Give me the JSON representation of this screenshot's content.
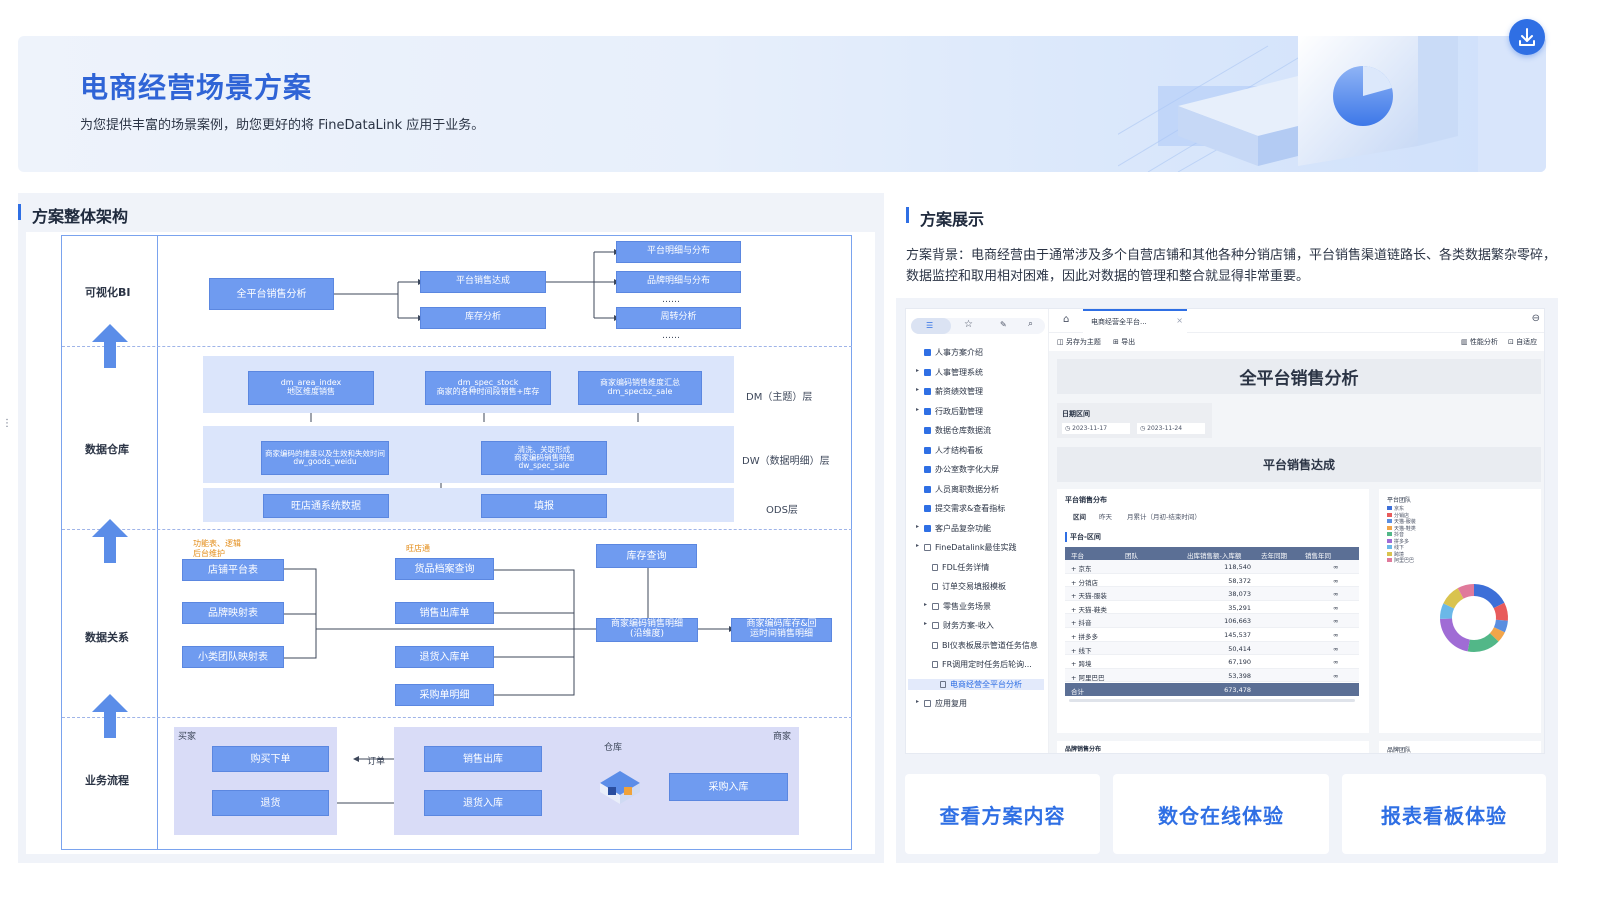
{
  "hero": {
    "title": "电商经营场景方案",
    "subtitle": "为您提供丰富的场景案例，助您更好的将 FineDataLink 应用于业务。"
  },
  "download_icon": "download-icon",
  "left": {
    "title": "方案整体架构",
    "rows": [
      "可视化BI",
      "数据仓库",
      "数据关系",
      "业务流程"
    ],
    "bi": {
      "root": "全平台销售分析",
      "mid": [
        "平台销售达成",
        "库存分析"
      ],
      "right": [
        "平台明细与分布",
        "品牌明细与分布",
        "……",
        "周转分析",
        "……"
      ]
    },
    "dw": {
      "dm_nodes": [
        "dm_area_index\n地区维度销售",
        "dm_spec_stock\n商家的各种时间段销售+库存",
        "商家编码销售维度汇总\ndm_specbz_sale"
      ],
      "dm_label": "DM（主题）层",
      "dw_nodes": [
        "商家编码的维度以及生效和失效时间\ndw_goods_weidu",
        "清洗、关联形成\n商家编码销售明细\ndw_spec_sale"
      ],
      "dw_label": "DW（数据明细）层",
      "ods_nodes": [
        "旺店通系统数据",
        "填报"
      ],
      "ods_label": "ODS层"
    },
    "rel": {
      "note1": "功能表、逻辑\n后台维护",
      "note2": "旺店通",
      "left_nodes": [
        "店铺平台表",
        "品牌映射表",
        "小类团队映射表"
      ],
      "mid_nodes": [
        "货品档案查询",
        "销售出库单",
        "退货入库单",
        "采购单明细"
      ],
      "top_node": "库存查询",
      "center": "商家编码销售明细\n(沿维度)",
      "right": "商家编码库存&回\n运时间销售明细"
    },
    "flow": {
      "buyer": "买家",
      "seller": "商家",
      "warehouse": "仓库",
      "order": "订单",
      "nodes": [
        "购买下单",
        "退货",
        "销售出库",
        "退货入库",
        "采购入库"
      ]
    }
  },
  "right": {
    "title": "方案展示",
    "background": "方案背景：电商经营由于通常涉及多个自营店铺和其他各种分销店铺，平台销售渠道链路长、各类数据繁杂零碎，数据监控和取用相对困难，因此对数据的管理和整合就显得非常重要。",
    "preview": {
      "tab": "电商经营全平台...",
      "toolbar_left": [
        "另存为主题",
        "导出"
      ],
      "toolbar_right": [
        "性能分析",
        "自适应"
      ],
      "report_title": "全平台销售分析",
      "date_label": "日期区间",
      "date_from": "2023-11-17",
      "date_to": "2023-11-24",
      "section_title": "平台销售达成",
      "sub_title": "平台销售分布",
      "tabs": [
        "区间",
        "昨天",
        "月累计（月初-结束时间）"
      ],
      "table_title": "平台-区间",
      "table_headers": [
        "平台",
        "团队",
        "出库销售额-入库额",
        "去年同期",
        "销售年同"
      ],
      "table_rows": [
        [
          "京东",
          "118,540"
        ],
        [
          "分销店",
          "58,372"
        ],
        [
          "天猫-服装",
          "38,073"
        ],
        [
          "天猫-鞋类",
          "35,291"
        ],
        [
          "抖音",
          "106,663"
        ],
        [
          "拼多多",
          "145,537"
        ],
        [
          "线下",
          "50,414"
        ],
        [
          "跨境",
          "67,190"
        ],
        [
          "阿里巴巴",
          "53,398"
        ]
      ],
      "table_total": [
        "合计",
        "673,478"
      ],
      "bottom_left": "品牌销售分布",
      "bottom_right": "品牌团队",
      "donut_title": "平台团队",
      "donut_legend": [
        "京东",
        "分销店",
        "天猫-服装",
        "天猫-鞋类",
        "抖音",
        "拼多多",
        "线下",
        "跨境",
        "阿里巴巴"
      ],
      "tree": [
        "人事方案介绍",
        "人事管理系统",
        "薪资绩效管理",
        "行政后勤管理",
        "数据仓库数据流",
        "人才结构看板",
        "办公室数字化大屏",
        "人员离职数据分析",
        "提交需求&查看指标",
        "客户品复杂功能",
        "FineDatalink最佳实践",
        "FDL任务详情",
        "订单交易填报模板",
        "零售业务场景",
        "财务方案-收入",
        "BI仪表板展示管道任务信息",
        "FR调用定时任务后轮询...",
        "电商经营全平台分析",
        "应用复用"
      ]
    },
    "cards": [
      "查看方案内容",
      "数仓在线体验",
      "报表看板体验"
    ]
  }
}
